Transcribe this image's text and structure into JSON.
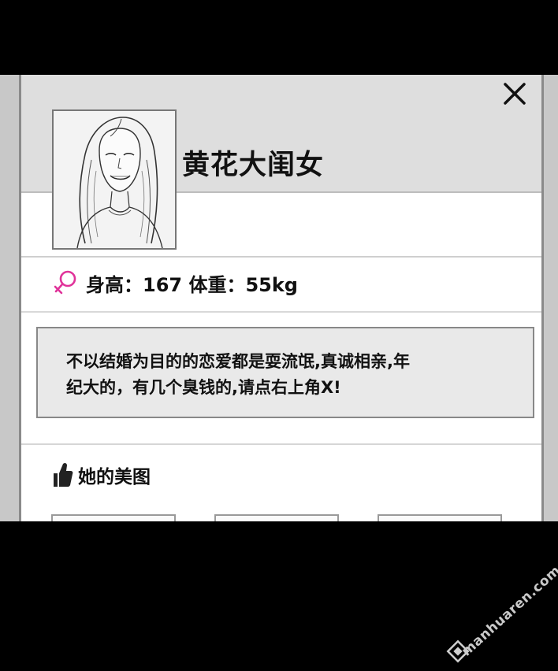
{
  "profile": {
    "name": "黄花大闺女",
    "stats": "身高：167 体重：55kg",
    "bio_line1": "不以结婚为目的的恋爱都是耍流氓,真诚相亲,年",
    "bio_line2": "纪大的，有几个臭钱的,请点右上角X!",
    "gender_icon": "female-symbol-icon",
    "gender_color": "#e0339a"
  },
  "photos": {
    "title": "她的美图",
    "icon": "thumbs-up-icon"
  },
  "close": {
    "icon": "close-x-icon"
  },
  "watermark": {
    "text": "manhuaren.com"
  }
}
